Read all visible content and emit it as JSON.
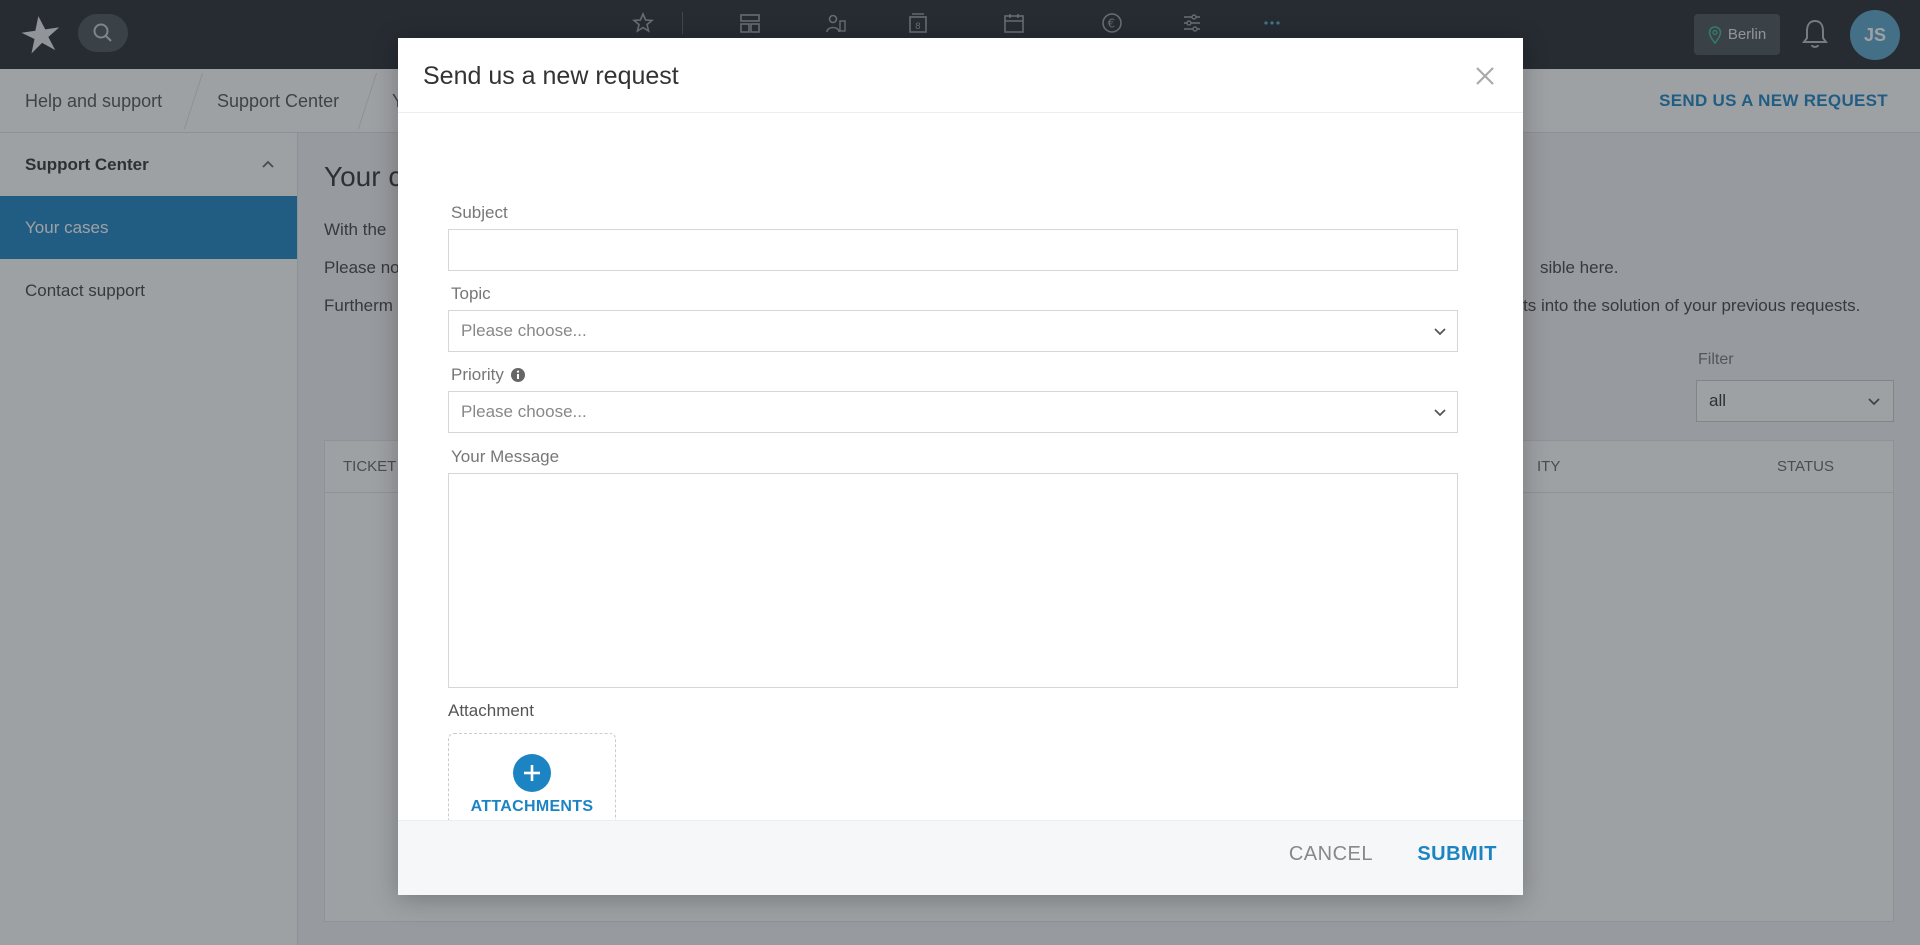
{
  "topbar": {
    "location_label": "Berlin",
    "avatar_initials": "JS",
    "nav_icons": [
      "star-icon",
      "dashboard-icon",
      "people-icon",
      "stacked-dates-icon",
      "calendar-icon",
      "euro-icon",
      "sliders-icon",
      "more-icon"
    ]
  },
  "breadcrumb": {
    "items": [
      "Help and support",
      "Support Center",
      "Y"
    ],
    "action_label": "SEND US A NEW REQUEST"
  },
  "sidebar": {
    "header": "Support Center",
    "items": [
      {
        "label": "Your cases",
        "active": true
      },
      {
        "label": "Contact support",
        "active": false
      }
    ]
  },
  "main": {
    "title_visible": "Your c",
    "line1": "With the",
    "line2_left": "Please no",
    "line2_right": "sible here.",
    "line3_left": "Furtherm",
    "line3_right": "ts into the solution of your previous requests.",
    "filter_label": "Filter",
    "filter_value": "all",
    "columns": [
      "TICKET",
      "ITY",
      "STATUS"
    ]
  },
  "modal": {
    "title": "Send us a new request",
    "subject_label": "Subject",
    "subject_value": "",
    "topic_label": "Topic",
    "topic_placeholder": "Please choose...",
    "priority_label": "Priority",
    "priority_placeholder": "Please choose...",
    "message_label": "Your Message",
    "message_value": "",
    "attachment_label": "Attachment",
    "attachments_button": "ATTACHMENTS",
    "cancel_label": "CANCEL",
    "submit_label": "SUBMIT"
  },
  "colors": {
    "accent": "#1d84c4",
    "topbar": "#262b31",
    "avatar": "#5aa6c9"
  }
}
